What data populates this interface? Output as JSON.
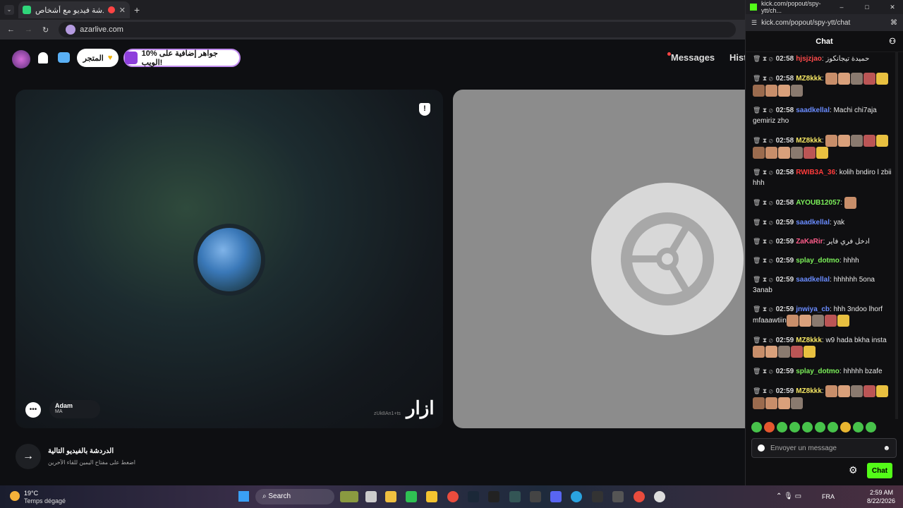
{
  "browser": {
    "tab_title": "أزاردردشة فيديو مع أشخاص",
    "url": "azarlive.com",
    "new_tab": "+"
  },
  "page": {
    "shop_label": "المتجر",
    "promo_label": "10% جواهر إضافية على الويب!",
    "messages_label": "Messages",
    "history_label": "Hist",
    "next_title": "الدردشة بالفيديو التالية",
    "next_subtitle": "اضغط على مفتاح اليمين للقاء الآخرين",
    "partner_name": "Adam",
    "partner_country": "MA",
    "watermark": "zUk8An1+ts",
    "logo": "ازار"
  },
  "kick": {
    "window_title": "kick.com/popout/spy-ytt/ch...",
    "url": "kick.com/popout/spy-ytt/chat",
    "chat_title": "Chat",
    "input_placeholder": "Envoyer un message",
    "send_label": "Chat",
    "messages": [
      {
        "time": "02:58",
        "user": "hjsjzjao",
        "color": "#ff4a4a",
        "text": "حميدة تيجانكوز"
      },
      {
        "time": "02:58",
        "user": "MZ8kkk",
        "color": "#f5e663",
        "text": "",
        "emotes": 9
      },
      {
        "time": "02:58",
        "user": "saadkellal",
        "color": "#6a8cff",
        "text": "Machi chi7aja gemiriz zho"
      },
      {
        "time": "02:58",
        "user": "MZ8kkk",
        "color": "#f5e663",
        "text": "",
        "emotes": 11
      },
      {
        "time": "02:58",
        "user": "RWIB3A_36",
        "color": "#ff3b3b",
        "text": "kolih bndiro l zbii hhh"
      },
      {
        "time": "02:58",
        "user": "AYOUB12057",
        "color": "#7cf05a",
        "text": "",
        "emotes": 1
      },
      {
        "time": "02:59",
        "user": "saadkellal",
        "color": "#6a8cff",
        "text": "yak"
      },
      {
        "time": "02:59",
        "user": "ZaKaRir",
        "color": "#ff5c8a",
        "text": "ادخل فري فاير"
      },
      {
        "time": "02:59",
        "user": "splay_dotmo",
        "color": "#7cf05a",
        "text": "hhhh"
      },
      {
        "time": "02:59",
        "user": "saadkellal",
        "color": "#6a8cff",
        "text": "hhhhhh 5ona 3anab"
      },
      {
        "time": "02:59",
        "user": "jnwiya_cb",
        "color": "#6a8cff",
        "text": "hhh 3ndoo lhorf mfaaawtiin",
        "emotes": 5
      },
      {
        "time": "02:59",
        "user": "MZ8kkk",
        "color": "#f5e663",
        "text": "w9 hada bkha insta",
        "emotes": 5
      },
      {
        "time": "02:59",
        "user": "splay_dotmo",
        "color": "#7cf05a",
        "text": "hhhhh bzafe"
      },
      {
        "time": "02:59",
        "user": "MZ8kkk",
        "color": "#f5e663",
        "text": "",
        "emotes": 9
      }
    ]
  },
  "taskbar": {
    "temp": "19°C",
    "weather": "Temps dégagé",
    "search": "Search",
    "lang": "FRA",
    "time": "2:59 AM",
    "date": "8/22/2026"
  }
}
